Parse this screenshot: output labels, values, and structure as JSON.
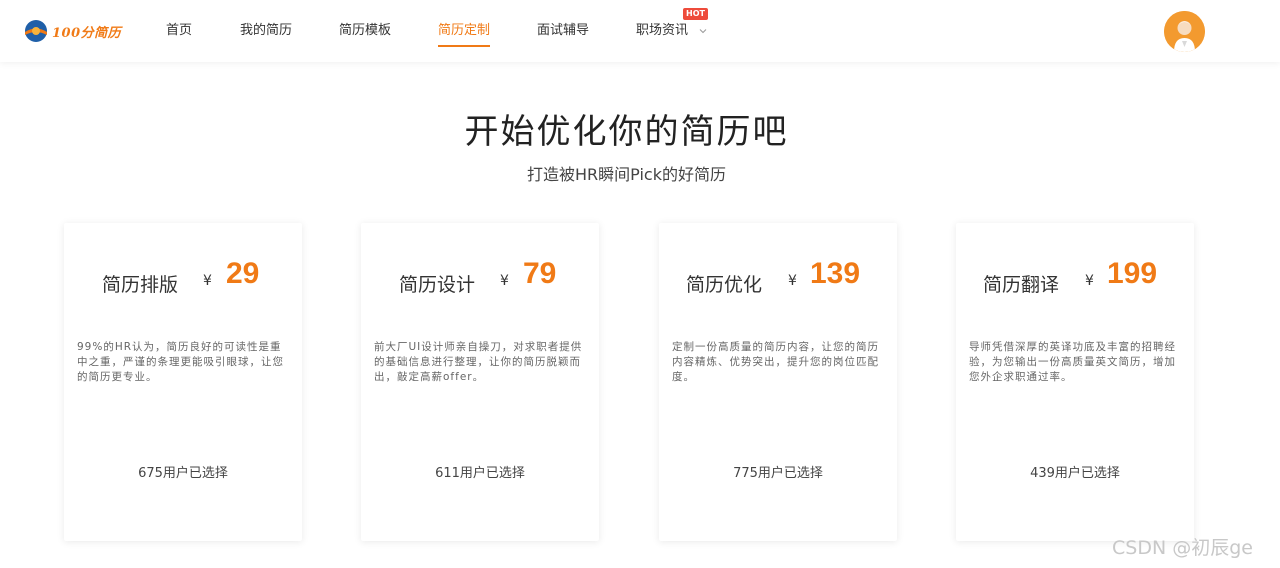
{
  "header": {
    "logo_text": "100分简历",
    "nav": [
      {
        "label": "首页"
      },
      {
        "label": "我的简历"
      },
      {
        "label": "简历模板"
      },
      {
        "label": "简历定制"
      },
      {
        "label": "面试辅导"
      },
      {
        "label": "职场资讯"
      }
    ],
    "active_nav": "简历定制",
    "hot_badge": "HOT"
  },
  "main": {
    "title": "开始优化你的简历吧",
    "subtitle": "打造被HR瞬间Pick的好简历"
  },
  "cards": [
    {
      "name": "简历排版",
      "currency": "¥",
      "price": "29",
      "desc": "99%的HR认为，简历良好的可读性是重中之重，严谨的条理更能吸引眼球，让您的简历更专业。",
      "count": "675用户已选择"
    },
    {
      "name": "简历设计",
      "currency": "¥",
      "price": "79",
      "desc": "前大厂UI设计师亲自操刀，对求职者提供的基础信息进行整理，让你的简历脱颖而出，敲定高薪offer。",
      "count": "611用户已选择"
    },
    {
      "name": "简历优化",
      "currency": "¥",
      "price": "139",
      "desc": "定制一份高质量的简历内容，让您的简历内容精炼、优势突出，提升您的岗位匹配度。",
      "count": "775用户已选择"
    },
    {
      "name": "简历翻译",
      "currency": "¥",
      "price": "199",
      "desc": "导师凭借深厚的英译功底及丰富的招聘经验，为您输出一份高质量英文简历，增加您外企求职通过率。",
      "count": "439用户已选择"
    }
  ],
  "watermark": "CSDN @初辰ge",
  "colors": {
    "accent": "#f07a16",
    "hot": "#ee4b3b",
    "avatar_bg": "#f39a2f"
  }
}
